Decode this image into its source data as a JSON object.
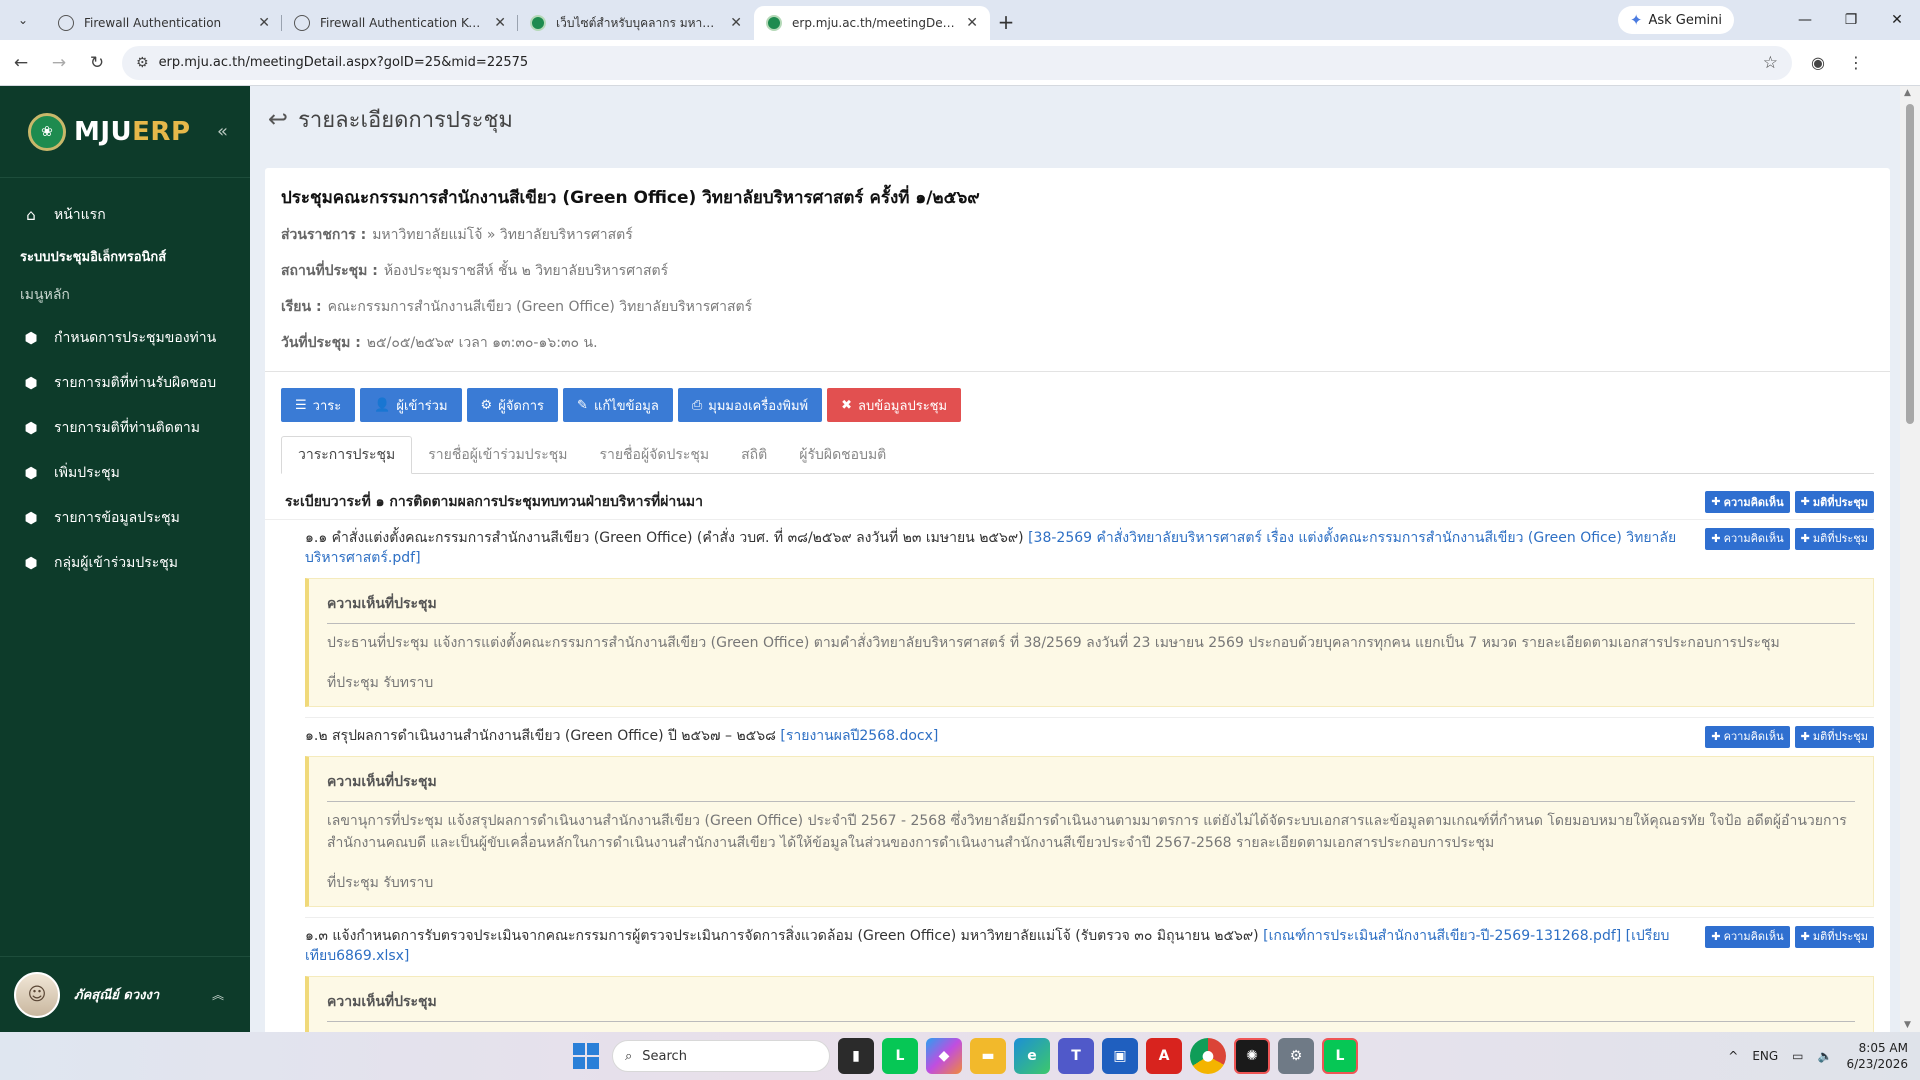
{
  "browser": {
    "tabs": [
      {
        "title": "Firewall Authentication",
        "icon": "globe-icon",
        "active": false
      },
      {
        "title": "Firewall Authentication Keepalive",
        "icon": "globe-icon",
        "active": false
      },
      {
        "title": "เว็บไซต์สำหรับบุคลากร มหาวิทยาลัยแม่โจ้",
        "icon": "mju-icon",
        "active": false
      },
      {
        "title": "erp.mju.ac.th/meetingDetail.aspx",
        "icon": "mju-icon",
        "active": true
      }
    ],
    "gemini_label": "Ask Gemini",
    "url": "erp.mju.ac.th/meetingDetail.aspx?goID=25&mid=22575"
  },
  "sidebar": {
    "brand_prefix": "MJU",
    "brand_suffix": "ERP",
    "home": "หน้าแรก",
    "section_title": "ระบบประชุมอิเล็กทรอนิกส์",
    "menu_label": "เมนูหลัก",
    "items": [
      "กำหนดการประชุมของท่าน",
      "รายการมติที่ท่านรับผิดชอบ",
      "รายการมติที่ท่านติดตาม",
      "เพิ่มประชุม",
      "รายการข้อมูลประชุม",
      "กลุ่มผู้เข้าร่วมประชุม"
    ],
    "user_name": "ภัคสุณีย์ ดวงงา"
  },
  "page": {
    "heading": "รายละเอียดการประชุม",
    "meeting_title": "ประชุมคณะกรรมการสำนักงานสีเขียว (Green Office) วิทยาลัยบริหารศาสตร์  ครั้งที่ ๑/๒๕๖๙",
    "meta": [
      {
        "label": "ส่วนราชการ :",
        "value": "มหาวิทยาลัยแม่โจ้ » วิทยาลัยบริหารศาสตร์"
      },
      {
        "label": "สถานที่ประชุม :",
        "value": "ห้องประชุมราชสีห์ ชั้น ๒ วิทยาลัยบริหารศาสตร์"
      },
      {
        "label": "เรียน :",
        "value": "คณะกรรมการสำนักงานสีเขียว (Green Office) วิทยาลัยบริหารศาสตร์"
      },
      {
        "label": "วันที่ประชุม :",
        "value": "๒๕/๐๕/๒๕๖๙ เวลา ๑๓:๓๐-๑๖:๓๐ น."
      }
    ],
    "buttons": [
      {
        "label": "วาระ",
        "icon": "list-icon"
      },
      {
        "label": "ผู้เข้าร่วม",
        "icon": "user-icon"
      },
      {
        "label": "ผู้จัดการ",
        "icon": "gear-icon"
      },
      {
        "label": "แก้ไขข้อมูล",
        "icon": "pencil-icon"
      },
      {
        "label": "มุมมองเครื่องพิมพ์",
        "icon": "printer-icon"
      },
      {
        "label": "ลบข้อมูลประชุม",
        "icon": "close-icon"
      }
    ],
    "tabs": [
      "วาระการประชุม",
      "รายชื่อผู้เข้าร่วมประชุม",
      "รายชื่อผู้จัดประชุม",
      "สถิติ",
      "ผู้รับผิดชอบมติ"
    ],
    "add_comment_label": "ความคิดเห็น",
    "add_resolution_label": "มติที่ประชุม",
    "agenda_title": "ระเบียบวาระที่ ๑ การติดตามผลการประชุมทบทวนฝ่ายบริหารที่ผ่านมา",
    "agenda_items": [
      {
        "text": "๑.๑ คำสั่งแต่งตั้งคณะกรรมการสำนักงานสีเขียว (Green Office) (คำสั่ง วบศ. ที่ ๓๘/๒๕๖๙ ลงวันที่ ๒๓ เมษายน ๒๕๖๙)",
        "attachment": "[38-2569 คำสั่งวิทยาลัยบริหารศาสตร์ เรื่อง แต่งตั้งคณะกรรมการสำนักงานสีเขียว (Green Ofice) วิทยาลัยบริหารศาสตร์.pdf]",
        "comment_title": "ความเห็นที่ประชุม",
        "comment_body": "ประธานที่ประชุม แจ้งการแต่งตั้งคณะกรรมการสำนักงานสีเขียว (Green Office) ตามคำสั่งวิทยาลัยบริหารศาสตร์ ที่ 38/2569 ลงวันที่ 23 เมษายน 2569 ประกอบด้วยบุคลากรทุกคน แยกเป็น 7 หมวด รายละเอียดตามเอกสารประกอบการประชุม",
        "resolution": "ที่ประชุม รับทราบ"
      },
      {
        "text": "๑.๒ สรุปผลการดำเนินงานสำนักงานสีเขียว (Green Office) ปี ๒๕๖๗ – ๒๕๖๘",
        "attachment": "[รายงานผลปี2568.docx]",
        "comment_title": "ความเห็นที่ประชุม",
        "comment_body": "เลขานุการที่ประชุม แจ้งสรุปผลการดำเนินงานสำนักงานสีเขียว (Green Office) ประจำปี 2567 - 2568 ซึ่งวิทยาลัยมีการดำเนินงานตามมาตรการ แต่ยังไม่ได้จัดระบบเอกสารและข้อมูลตามเกณฑ์ที่กำหนด โดยมอบหมายให้คุณอรทัย ใจป้อ อดีตผู้อำนวยการสำนักงานคณบดี และเป็นผู้ขับเคลื่อนหลักในการดำเนินงานสำนักงานสีเขียว ได้ให้ข้อมูลในส่วนของการดำเนินงานสำนักงานสีเขียวประจำปี 2567-2568 รายละเอียดตามเอกสารประกอบการประชุม",
        "resolution": "ที่ประชุม รับทราบ"
      },
      {
        "text": "๑.๓ แจ้งกำหนดการรับตรวจประเมินจากคณะกรรมการผู้ตรวจประเมินการจัดการสิ่งแวดล้อม (Green Office) มหาวิทยาลัยแม่โจ้ (รับตรวจ ๓๐ มิถุนายน ๒๕๖๙)",
        "attachment": "[เกณฑ์การประเมินสำนักงานสีเขียว-ปี-2569-131268.pdf] [เปรียบเทียบ6869.xlsx]",
        "comment_title": "ความเห็นที่ประชุม",
        "comment_body": "",
        "resolution": ""
      }
    ]
  },
  "taskbar": {
    "search_placeholder": "Search",
    "lang": "ENG",
    "time": "8:05 AM",
    "date": "6/23/2026"
  }
}
